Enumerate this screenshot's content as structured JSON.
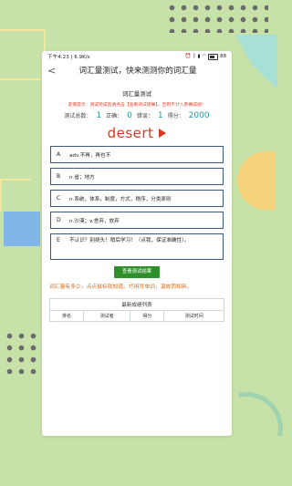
{
  "status_bar": {
    "time_speed": "下午4:23 | 6.9K/s",
    "icons": [
      "alarm-icon",
      "bluetooth-icon",
      "signal-icon",
      "wifi-icon"
    ],
    "battery": "88"
  },
  "header": {
    "back_glyph": "<",
    "title": "词汇量测试，快来测测你的词汇量"
  },
  "quiz": {
    "section_title": "词汇量测试",
    "tip": "友情提示：测试完成后请点击【查看测试结果】，否则不计入参赛成绩！",
    "stats": {
      "total_label": "测试总数：",
      "total_value": "1",
      "correct_label": "正确：",
      "correct_value": "0",
      "wrong_label": "错误：",
      "wrong_value": "1",
      "score_label": "得分：",
      "score_value": "2000"
    },
    "word": "desert",
    "options": [
      {
        "letter": "A",
        "text": "adv.不再，再也不"
      },
      {
        "letter": "B",
        "text": "n.省；地方"
      },
      {
        "letter": "C",
        "text": "n.系统，体系，制度，方式，秩序，分类原则"
      },
      {
        "letter": "D",
        "text": "n.沙漠；v.舍弃，放弃"
      },
      {
        "letter": "E",
        "text": "不认识？别挠头！稍后学习！（点我，保证准确性）。"
      }
    ],
    "result_button": "查看测试结果",
    "hint": "词汇量有多少，点点鼠标就知道。巧用背单词，温故而知新。"
  },
  "leaderboard": {
    "caption": "最新成绩列表",
    "columns": [
      "排名",
      "测试者",
      "得分",
      "测试时间"
    ]
  },
  "colors": {
    "background": "#c7e2a8",
    "accent_teal": "#1d9aa0",
    "word_red": "#e2361c",
    "button_green": "#2f8f2a",
    "hint_orange": "#d26a17"
  }
}
